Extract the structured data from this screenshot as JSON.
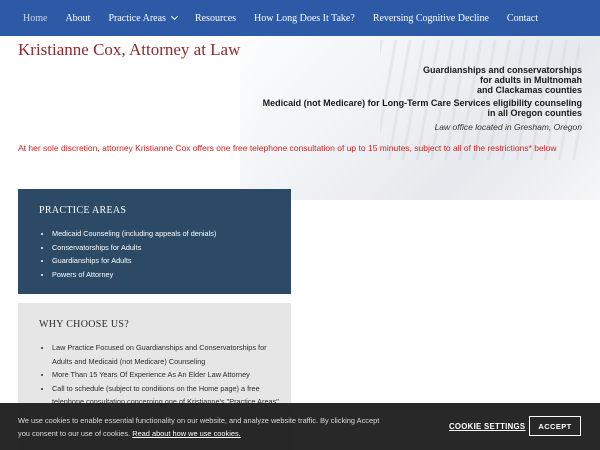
{
  "nav": {
    "items": [
      {
        "label": "Home"
      },
      {
        "label": "About"
      },
      {
        "label": "Practice Areas"
      },
      {
        "label": "Resources"
      },
      {
        "label": "How Long Does It Take?"
      },
      {
        "label": "Reversing Cognitive Decline"
      },
      {
        "label": "Contact"
      }
    ]
  },
  "header": {
    "title": "Kristianne Cox, Attorney at Law",
    "tagline1": [
      "Guardianships and conservatorships",
      "for adults in Multnomah",
      "and Clackamas counties"
    ],
    "tagline2": [
      "Medicaid (not Medicare) for Long-Term Care Services eligibility counseling",
      "in all Oregon counties"
    ],
    "location": "Law office located in Gresham, Oregon"
  },
  "notice": "At her sole discretion, attorney Kristianne Cox offers one free telephone consultation of up to 15 minutes, subject to all of the restrictions* below",
  "practice_areas": {
    "title": "PRACTICE AREAS",
    "items": [
      "Medicaid Counseling (including appeals of denials)",
      "Conservatorships for Adults",
      "Guardianships for Adults",
      "Powers of Attorney"
    ]
  },
  "why_choose": {
    "title": "WHY CHOOSE US?",
    "items": [
      "Law Practice Focused on Guardianships and Conservatorships for Adults and Medicaid (not Medicare) Counseling",
      "More Than 15 Years Of Experience As An Elder Law Attorney",
      "Call to schedule (subject to conditions on the Home page) a free telephone consultation concerning one of Kristianne's \"Practice Areas\""
    ]
  },
  "cookie": {
    "text": "We use cookies to enable essential functionality on our website, and analyze website traffic. By clicking Accept you consent to our use of cookies.",
    "link": "Read about how we use cookies.",
    "settings": "COOKIE SETTINGS",
    "accept": "ACCEPT"
  },
  "colors": {
    "nav_bg": "#2d5aa6",
    "title": "#8e2a2a",
    "notice": "#d62020",
    "practice_box": "#2c4a66",
    "why_box": "#e6e6e6"
  }
}
